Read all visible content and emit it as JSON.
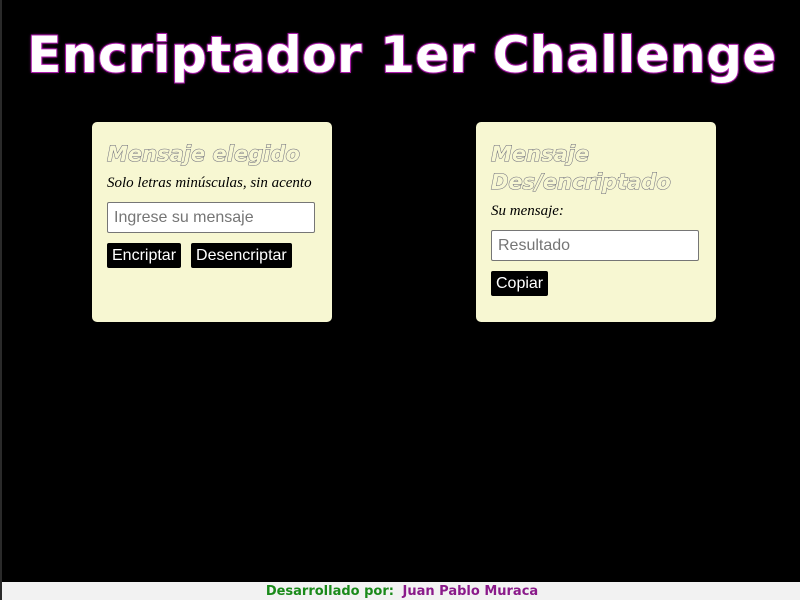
{
  "header": {
    "title": "Encriptador 1er Challenge"
  },
  "input_card": {
    "heading": "Mensaje elegido",
    "instruction": "Solo letras minúsculas, sin acento",
    "input_value": "",
    "input_placeholder": "Ingrese su mensaje",
    "encrypt_label": "Encriptar",
    "decrypt_label": "Desencriptar"
  },
  "output_card": {
    "heading": "Mensaje Des/encriptado",
    "label": "Su mensaje:",
    "result_value": "",
    "result_placeholder": "Resultado",
    "copy_label": "Copiar"
  },
  "footer": {
    "label": "Desarrollado por:",
    "author": "Juan Pablo Muraca"
  },
  "colors": {
    "background": "#000000",
    "card": "#f7f7d2",
    "title_outline": "#a01aa0",
    "footer_label": "#1a8a1a",
    "footer_author": "#8a1a8a"
  }
}
